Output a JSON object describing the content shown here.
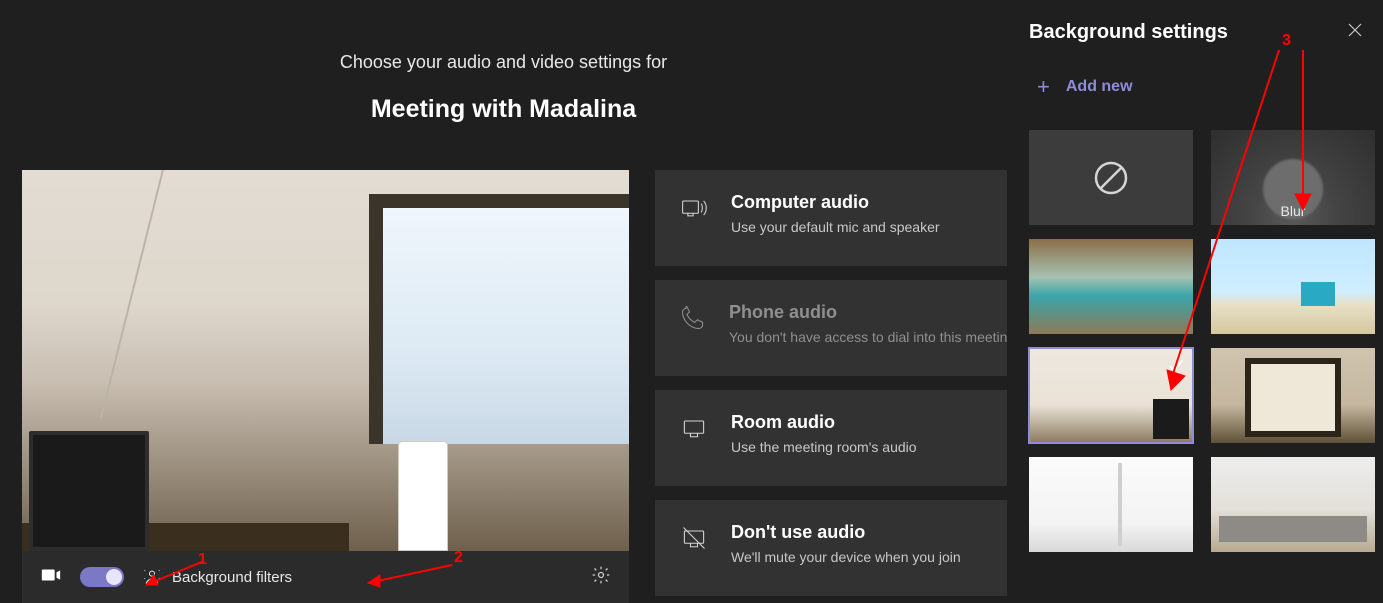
{
  "intro": {
    "subtitle": "Choose your audio and video settings for",
    "meeting_title": "Meeting with Madalina"
  },
  "toolbar": {
    "background_filters_label": "Background filters"
  },
  "audio_options": {
    "computer": {
      "title": "Computer audio",
      "desc": "Use your default mic and speaker"
    },
    "phone": {
      "title": "Phone audio",
      "desc": "You don't have access to dial into this meeting"
    },
    "room": {
      "title": "Room audio",
      "desc": "Use the meeting room's audio"
    },
    "none": {
      "title": "Don't use audio",
      "desc": "We'll mute your device when you join"
    }
  },
  "panel": {
    "title": "Background settings",
    "add_new": "Add new",
    "tiles": {
      "blur_label": "Blur"
    }
  },
  "annotations": {
    "n1": "1",
    "n2": "2",
    "n3": "3"
  }
}
